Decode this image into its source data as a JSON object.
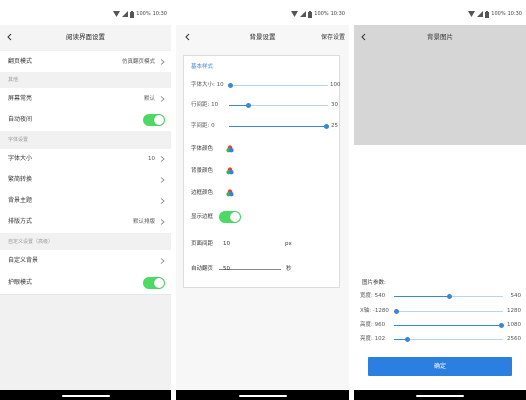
{
  "status": {
    "battery": "100%",
    "time": "10:30"
  },
  "colors": {
    "toggle_on": "#4cd964",
    "accent": "#3a86d8",
    "button": "#2b7fe0"
  },
  "reading_settings": {
    "title": "阅读界面设置",
    "page_mode": {
      "label": "翻页模式",
      "value": "仿真翻页模式"
    },
    "section_other": "其他",
    "screen_on": {
      "label": "屏幕常亮",
      "value": "默认"
    },
    "auto_night": {
      "label": "自动夜间",
      "on": true
    },
    "section_font": "字体设置",
    "font_size": {
      "label": "字体大小",
      "value": "10"
    },
    "convert": {
      "label": "繁简转换"
    },
    "bg_theme": {
      "label": "背景主题"
    },
    "layout": {
      "label": "排版方式",
      "value": "默认排版"
    },
    "section_custom": "自定义设置（高级）",
    "custom_bg": {
      "label": "自定义背景"
    },
    "eye_care": {
      "label": "护眼模式",
      "on": true
    }
  },
  "style_settings": {
    "title": "背景设置",
    "action": "保存设置",
    "section": "基本样式",
    "sliders": [
      {
        "label": "字体大小: 10",
        "max": "100",
        "position": 0.02
      },
      {
        "label": "行间距: 10",
        "max": "30",
        "position": 0.2
      },
      {
        "label": "字间距: 0",
        "max": "25",
        "position": 0.98
      }
    ],
    "font_color": "字体颜色",
    "bg_color": "背景颜色",
    "border_color": "边框颜色",
    "show_border": {
      "label": "显示边框",
      "on": true
    },
    "page_spacing": {
      "label": "页面间距",
      "value": "10",
      "unit": "px"
    },
    "auto_page": {
      "label": "自动翻页",
      "value": "50",
      "unit": "秒"
    }
  },
  "background_image": {
    "title": "背景图片",
    "params_label": "图片参数:",
    "sliders": [
      {
        "label": "宽度: 540",
        "max": "540",
        "position": 0.51
      },
      {
        "label": "X轴: -1280",
        "max": "1280",
        "position": 0.02
      },
      {
        "label": "高度: 960",
        "max": "1080",
        "position": 0.99
      },
      {
        "label": "亮度: 102",
        "max": "2560",
        "position": 0.12
      }
    ],
    "confirm": "确定"
  }
}
